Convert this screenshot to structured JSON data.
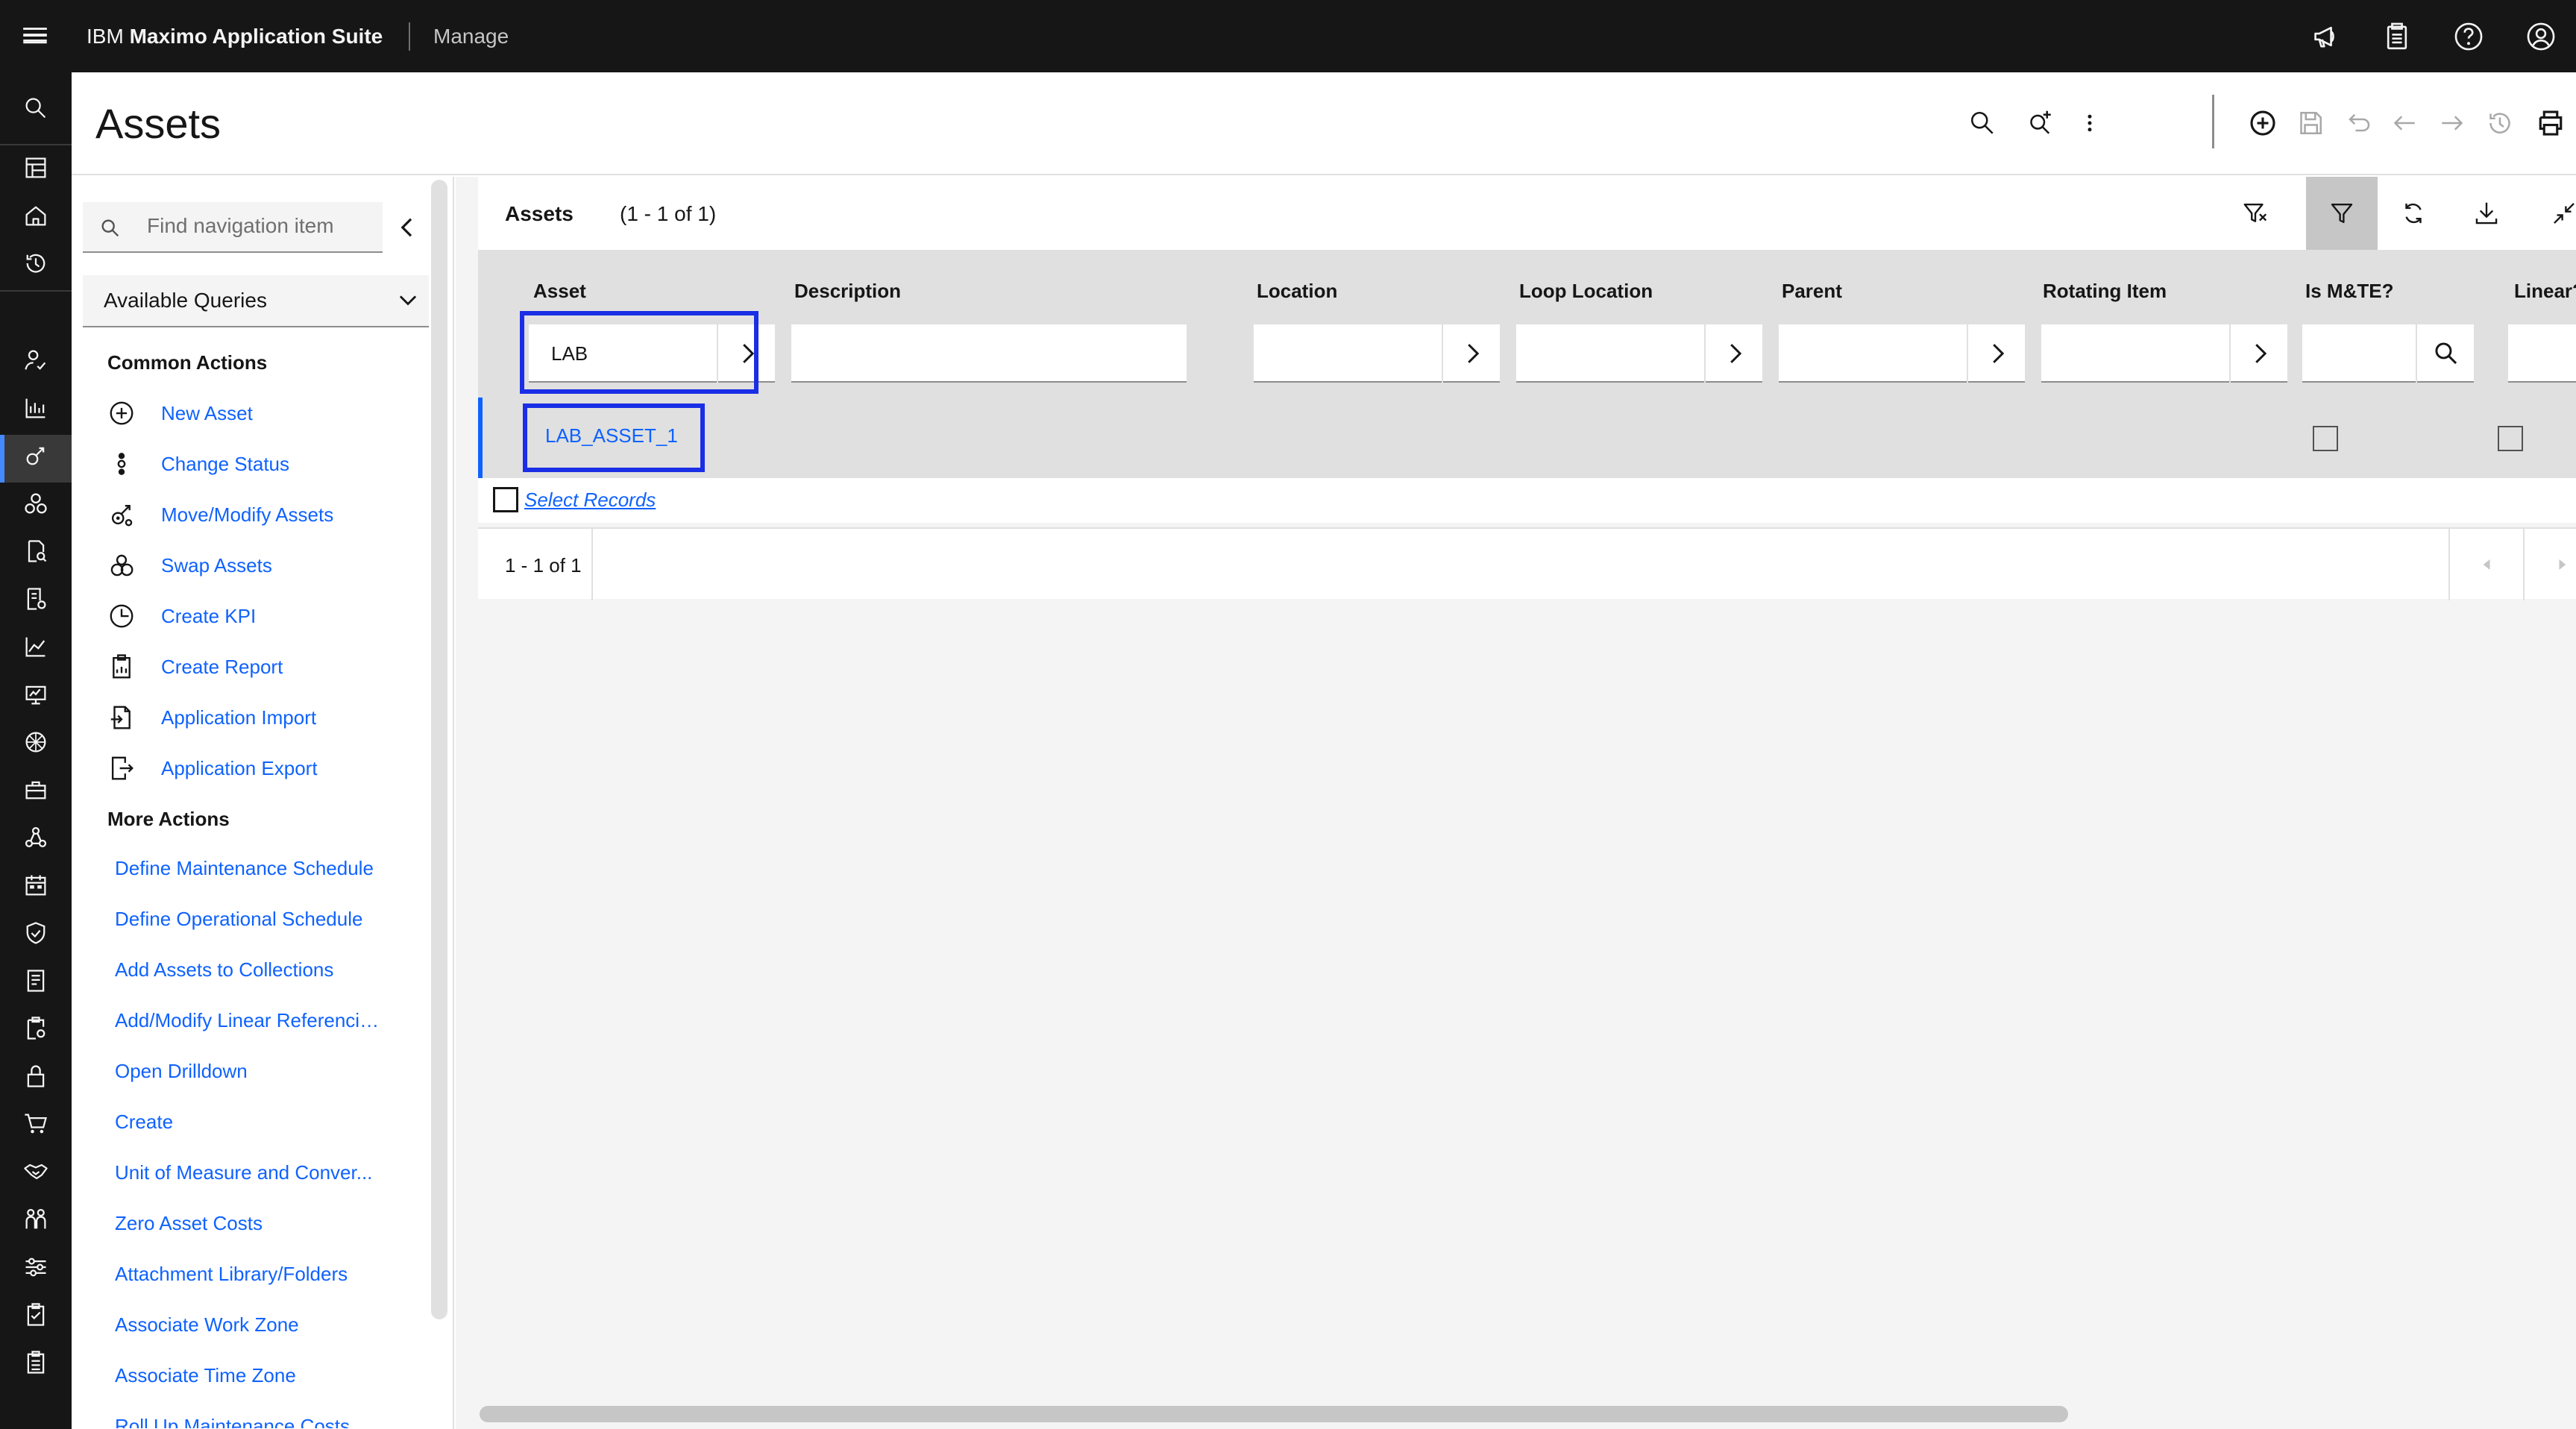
{
  "header": {
    "brand_prefix": "IBM ",
    "brand_name": "Maximo Application Suite",
    "app_name": "Manage"
  },
  "page": {
    "title": "Assets"
  },
  "nav": {
    "search_placeholder": "Find navigation item",
    "queries_label": "Available Queries",
    "common_actions_heading": "Common Actions",
    "common_actions": [
      {
        "label": "New Asset",
        "icon": "add-circle-icon"
      },
      {
        "label": "Change Status",
        "icon": "status-icon"
      },
      {
        "label": "Move/Modify Assets",
        "icon": "move-assets-icon"
      },
      {
        "label": "Swap Assets",
        "icon": "swap-assets-icon"
      },
      {
        "label": "Create KPI",
        "icon": "kpi-icon"
      },
      {
        "label": "Create Report",
        "icon": "report-icon"
      },
      {
        "label": "Application Import",
        "icon": "import-icon"
      },
      {
        "label": "Application Export",
        "icon": "export-icon"
      }
    ],
    "more_actions_heading": "More Actions",
    "more_actions": [
      {
        "label": "Define Maintenance Schedule",
        "expandable": false
      },
      {
        "label": "Define Operational Schedule",
        "expandable": false
      },
      {
        "label": "Add Assets to Collections",
        "expandable": false
      },
      {
        "label": "Add/Modify Linear Referencin...",
        "expandable": false
      },
      {
        "label": "Open Drilldown",
        "expandable": false
      },
      {
        "label": "Create",
        "expandable": true
      },
      {
        "label": "Unit of Measure and Conver...",
        "expandable": true
      },
      {
        "label": "Zero Asset Costs",
        "expandable": false
      },
      {
        "label": "Attachment Library/Folders",
        "expandable": true
      },
      {
        "label": "Associate Work Zone",
        "expandable": false
      },
      {
        "label": "Associate Time Zone",
        "expandable": false
      },
      {
        "label": "Roll Up Maintenance Costs",
        "expandable": false
      }
    ]
  },
  "table": {
    "title": "Assets",
    "count_text": "(1 - 1 of 1)",
    "columns": [
      {
        "label": "Asset",
        "filter_value": ""
      },
      {
        "label": "Description",
        "filter_value": ""
      },
      {
        "label": "Location",
        "filter_value": ""
      },
      {
        "label": "Loop Location",
        "filter_value": ""
      },
      {
        "label": "Parent",
        "filter_value": ""
      },
      {
        "label": "Rotating Item",
        "filter_value": ""
      },
      {
        "label": "Is M&TE?",
        "filter_value": ""
      },
      {
        "label": "Linear?",
        "filter_value": ""
      }
    ],
    "asset_filter_value": "LAB",
    "rows": [
      {
        "asset": "LAB_ASSET_1",
        "is_mte": false,
        "linear": false
      }
    ],
    "select_records_label": "Select Records",
    "pager_text": "1 - 1 of 1"
  },
  "colors": {
    "header_bg": "#161616",
    "link": "#0f62fe",
    "highlight_box": "#1a2ee6",
    "panel_bg": "#f4f4f4",
    "table_header_bg": "#e0e0e0"
  }
}
